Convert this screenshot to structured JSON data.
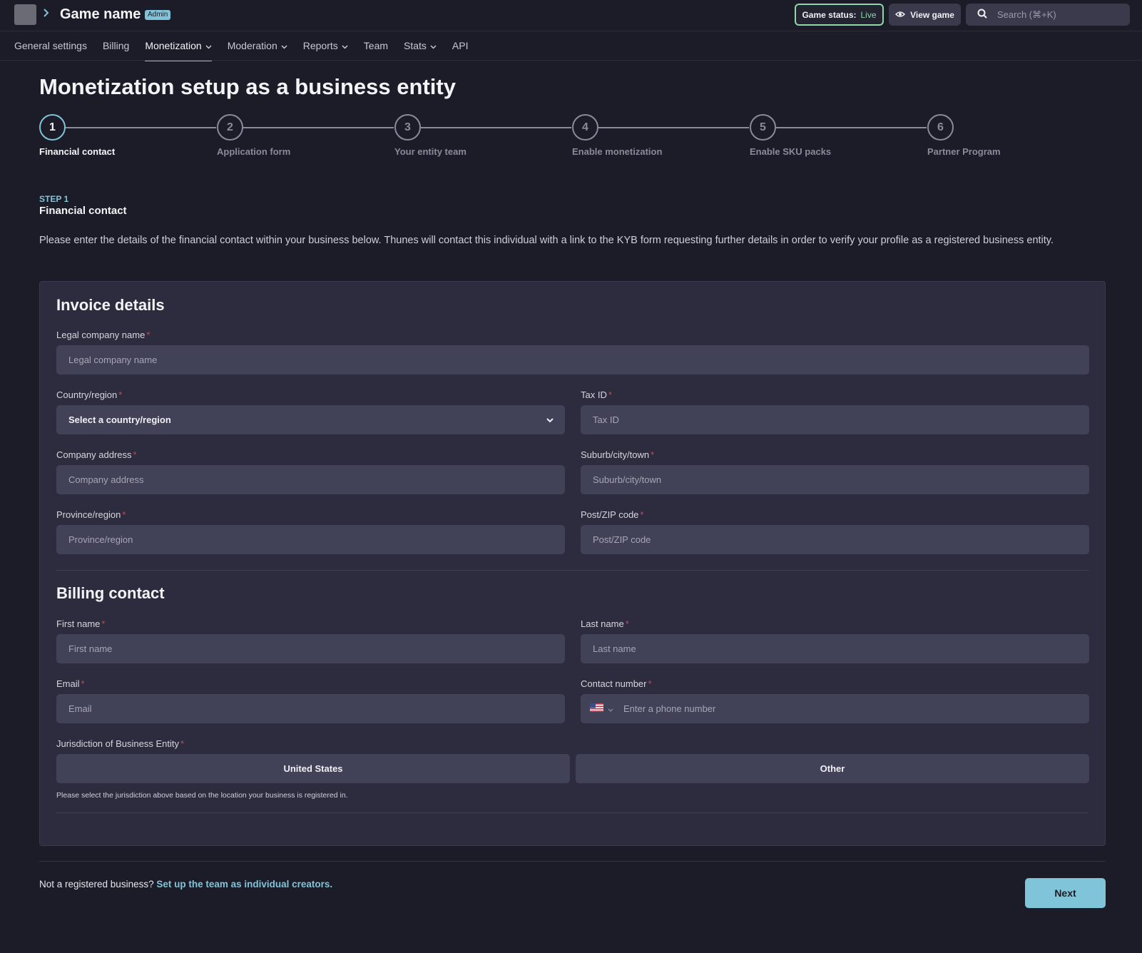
{
  "header": {
    "game_name": "Game name",
    "admin_badge": "Admin",
    "status_label": "Game status:",
    "status_value": "Live",
    "view_game": "View game",
    "search_placeholder": "Search (⌘+K)"
  },
  "nav": {
    "items": [
      {
        "label": "General settings",
        "dropdown": false,
        "active": false
      },
      {
        "label": "Billing",
        "dropdown": false,
        "active": false
      },
      {
        "label": "Monetization",
        "dropdown": true,
        "active": true
      },
      {
        "label": "Moderation",
        "dropdown": true,
        "active": false
      },
      {
        "label": "Reports",
        "dropdown": true,
        "active": false
      },
      {
        "label": "Team",
        "dropdown": false,
        "active": false
      },
      {
        "label": "Stats",
        "dropdown": true,
        "active": false
      },
      {
        "label": "API",
        "dropdown": false,
        "active": false
      }
    ]
  },
  "page": {
    "title": "Monetization setup as a business entity"
  },
  "stepper": {
    "steps": [
      {
        "number": "1",
        "label": "Financial contact",
        "active": true
      },
      {
        "number": "2",
        "label": "Application form",
        "active": false
      },
      {
        "number": "3",
        "label": "Your entity team",
        "active": false
      },
      {
        "number": "4",
        "label": "Enable monetization",
        "active": false
      },
      {
        "number": "5",
        "label": "Enable SKU packs",
        "active": false
      },
      {
        "number": "6",
        "label": "Partner Program",
        "active": false
      }
    ]
  },
  "step_info": {
    "step_number": "STEP 1",
    "step_title": "Financial contact",
    "description": "Please enter the details of the financial contact within your business below. Thunes will contact this individual with a link to the KYB form requesting further details in order to verify your profile as a registered business entity."
  },
  "invoice": {
    "title": "Invoice details",
    "legal_name": {
      "label": "Legal company name",
      "placeholder": "Legal company name"
    },
    "country": {
      "label": "Country/region",
      "value": "Select a country/region"
    },
    "tax_id": {
      "label": "Tax ID",
      "placeholder": "Tax ID"
    },
    "address": {
      "label": "Company address",
      "placeholder": "Company address"
    },
    "city": {
      "label": "Suburb/city/town",
      "placeholder": "Suburb/city/town"
    },
    "province": {
      "label": "Province/region",
      "placeholder": "Province/region"
    },
    "postcode": {
      "label": "Post/ZIP code",
      "placeholder": "Post/ZIP code"
    }
  },
  "billing": {
    "title": "Billing contact",
    "first_name": {
      "label": "First name",
      "placeholder": "First name"
    },
    "last_name": {
      "label": "Last name",
      "placeholder": "Last name"
    },
    "email": {
      "label": "Email",
      "placeholder": "Email"
    },
    "phone": {
      "label": "Contact number",
      "placeholder": "Enter a phone number",
      "country_flag": "us-flag-icon"
    },
    "jurisdiction": {
      "label": "Jurisdiction of Business Entity",
      "options": [
        "United States",
        "Other"
      ],
      "hint": "Please select the jurisdiction above based on the location your business is registered in."
    }
  },
  "footer": {
    "prompt": "Not a registered business?",
    "link": "Set up the team as individual creators.",
    "next": "Next"
  },
  "colors": {
    "background": "#1c1c28",
    "card": "#2c2c3e",
    "input": "#414157",
    "accent": "#7fc4d9",
    "live": "#8fd6a8",
    "required": "#c04a5a"
  }
}
